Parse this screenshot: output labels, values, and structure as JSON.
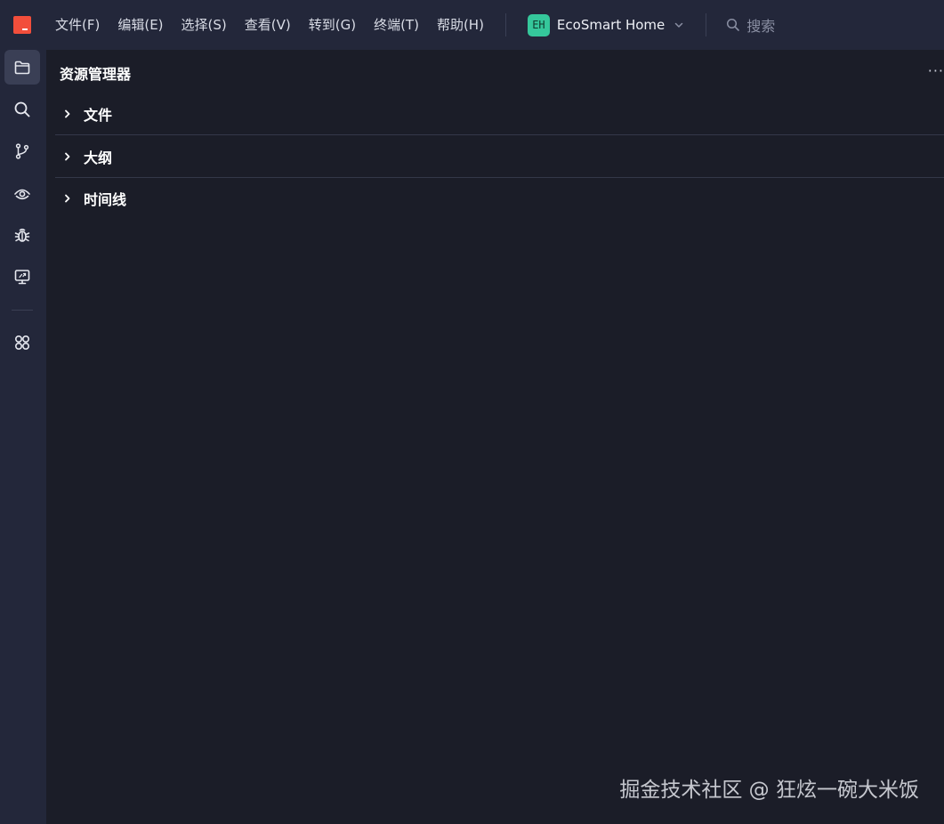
{
  "menu": {
    "items": [
      {
        "id": "file",
        "label": "文件(F)"
      },
      {
        "id": "edit",
        "label": "编辑(E)"
      },
      {
        "id": "selection",
        "label": "选择(S)"
      },
      {
        "id": "view",
        "label": "查看(V)"
      },
      {
        "id": "go",
        "label": "转到(G)"
      },
      {
        "id": "terminal",
        "label": "终端(T)"
      },
      {
        "id": "help",
        "label": "帮助(H)"
      }
    ]
  },
  "project": {
    "initials": "EH",
    "name": "EcoSmart Home",
    "avatar_color": "#35c79b"
  },
  "search": {
    "label": "搜索",
    "icon": "search-icon"
  },
  "activitybar": {
    "items": [
      {
        "id": "explorer",
        "icon": "folder-icon",
        "active": true
      },
      {
        "id": "search",
        "icon": "search-icon"
      },
      {
        "id": "source-control",
        "icon": "git-branch-icon"
      },
      {
        "id": "preview",
        "icon": "eye-icon"
      },
      {
        "id": "debug",
        "icon": "bug-icon"
      },
      {
        "id": "remote",
        "icon": "monitor-icon"
      },
      {
        "id": "extensions",
        "icon": "extensions-icon"
      }
    ]
  },
  "explorer": {
    "title": "资源管理器",
    "more": "···",
    "sections": [
      {
        "id": "files",
        "label": "文件"
      },
      {
        "id": "outline",
        "label": "大纲"
      },
      {
        "id": "timeline",
        "label": "时间线"
      }
    ]
  },
  "watermark": "掘金技术社区 @ 狂炫一碗大米饭",
  "colors": {
    "logo": "#f24e3b",
    "background": "#1b1d28",
    "chrome": "#23273a",
    "active_item": "#3a3f55"
  }
}
